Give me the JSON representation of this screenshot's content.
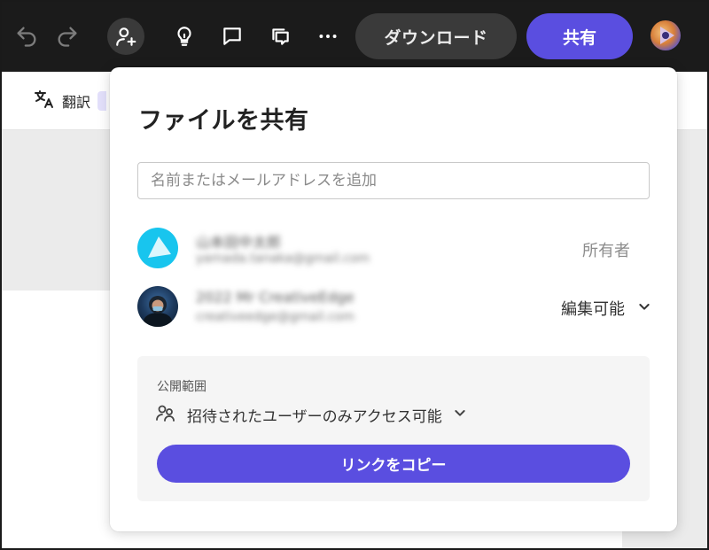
{
  "toolbar": {
    "download_label": "ダウンロード",
    "share_label": "共有",
    "icons": [
      "undo-icon",
      "redo-icon",
      "add-user-icon",
      "lightbulb-icon",
      "comment-icon",
      "comments-icon",
      "more-icon"
    ],
    "accent": "#5a4ee0"
  },
  "subbar": {
    "translate_label": "翻訳"
  },
  "dialog": {
    "title": "ファイルを共有",
    "input_placeholder": "名前またはメールアドレスを追加",
    "members": [
      {
        "name": "山本田中太郎",
        "email": "yamada.tanaka@gmail.com",
        "role": "所有者"
      },
      {
        "name": "2022 Mr CreativeEdge",
        "email": "creativeedge@gmail.com",
        "role": "編集可能"
      }
    ],
    "access": {
      "label": "公開範囲",
      "value": "招待されたユーザーのみアクセス可能",
      "copy_link_label": "リンクをコピー"
    }
  }
}
